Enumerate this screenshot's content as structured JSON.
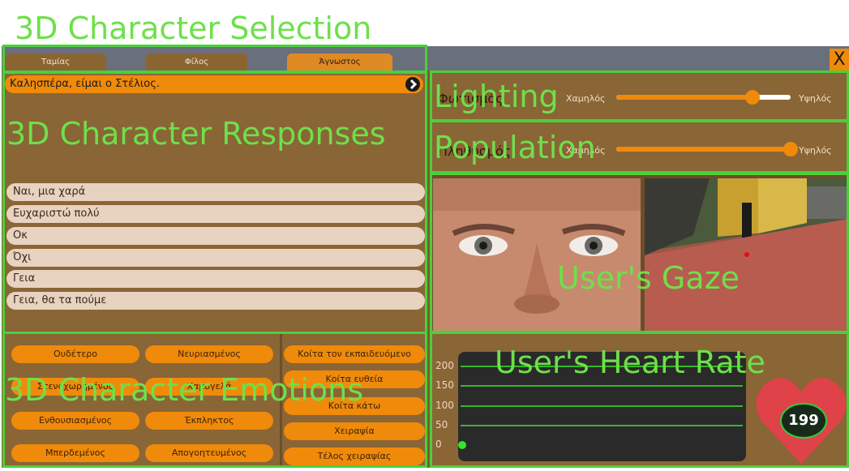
{
  "annotations": {
    "character_selection": "3D Character Selection",
    "character_responses": "3D Character Responses",
    "lighting": "Lighting",
    "population": "Population",
    "users_gaze": "User's Gaze",
    "users_heart_rate": "User's Heart Rate",
    "character_emotions": "3D Character Emotions"
  },
  "tabs": [
    "Ταμίας",
    "Φίλος",
    "Άγνωστος"
  ],
  "active_tab": "Άγνωστος",
  "close_label": "X",
  "character_message": "Καλησπέρα, είμαι ο Στέλιος.",
  "responses": [
    "Ναι, μια χαρά",
    "Ευχαριστώ πολύ",
    "Οκ",
    "Όχι",
    "Γεια",
    "Γεια, θα τα πούμε"
  ],
  "lighting": {
    "label": "Φωτισμός",
    "min_label": "Χαμηλός",
    "max_label": "Υψηλός",
    "value": 0.78
  },
  "population": {
    "label": "Πληθυσμός",
    "min_label": "Χαμηλός",
    "max_label": "Υψηλός",
    "value": 1.0
  },
  "emotions": [
    "Ουδέτερο",
    "Νευριασμένος",
    "Στενοχωρημένος",
    "Χαμογελά",
    "Ενθουσιασμένος",
    "Έκπληκτος",
    "Μπερδεμένος",
    "Απογοητευμένος"
  ],
  "actions": [
    "Κοίτα τον εκπαιδευόμενο",
    "Κοίτα ευθεία",
    "Κοίτα κάτω",
    "Χειραψία",
    "Τέλος χειραψίας"
  ],
  "heart_rate": {
    "value": "199"
  },
  "chart_data": {
    "type": "line",
    "yticks": [
      0,
      50,
      100,
      150,
      200
    ],
    "ylim": [
      0,
      200
    ],
    "series": [
      {
        "values": [
          0
        ]
      }
    ]
  },
  "colors": {
    "panel": "#8a6536",
    "accent_orange": "#f08a0a",
    "overlay_green": "#6ee04a",
    "heart_red": "#e0424a"
  }
}
